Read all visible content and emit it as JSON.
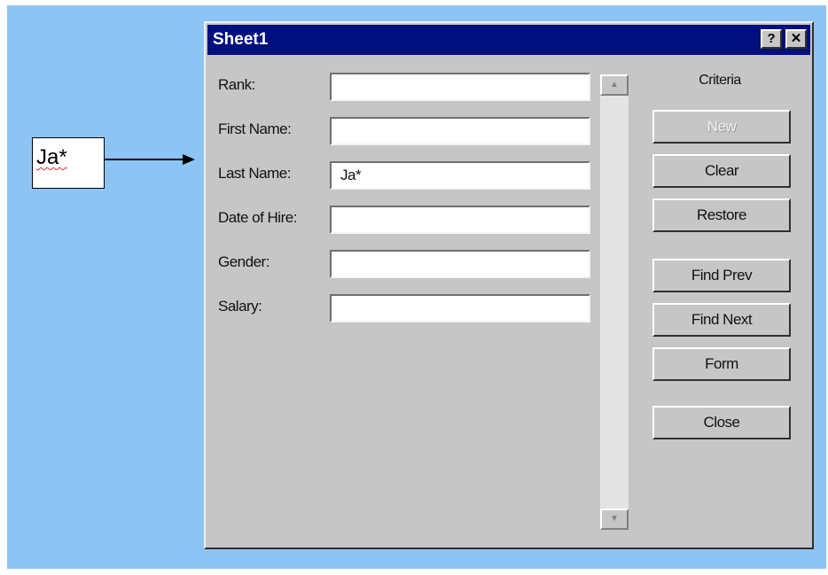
{
  "callout": {
    "text": "Ja*"
  },
  "dialog": {
    "title": "Sheet1",
    "help_button": "?",
    "close_button": "✕",
    "fields": [
      {
        "label": "Rank:",
        "value": ""
      },
      {
        "label": "First Name:",
        "value": ""
      },
      {
        "label": "Last Name:",
        "value": "Ja*"
      },
      {
        "label": "Date of Hire:",
        "value": ""
      },
      {
        "label": "Gender:",
        "value": ""
      },
      {
        "label": "Salary:",
        "value": ""
      }
    ],
    "criteria_label": "Criteria",
    "buttons": {
      "new": "New",
      "clear": "Clear",
      "restore": "Restore",
      "find_prev": "Find Prev",
      "find_next": "Find Next",
      "form": "Form",
      "close": "Close"
    },
    "scroll_up_glyph": "▲",
    "scroll_down_glyph": "▼"
  },
  "colors": {
    "background": "#8ec4f4",
    "titlebar": "#000f7e",
    "dialog_face": "#c6c6c6"
  }
}
